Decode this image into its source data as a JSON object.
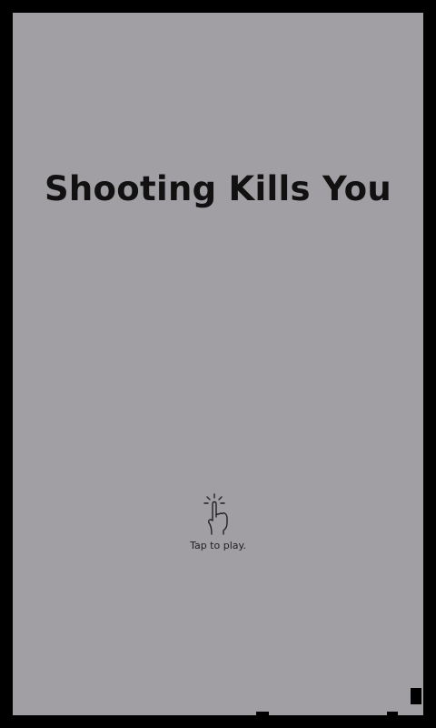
{
  "game": {
    "title": "Shooting Kills You",
    "tap_prompt": "Tap to play.",
    "tap_icon": "finger-tap-icon"
  },
  "colors": {
    "frame": "#000000",
    "background": "#a19fa3",
    "title_text": "#111111",
    "hint_text": "#222222"
  }
}
